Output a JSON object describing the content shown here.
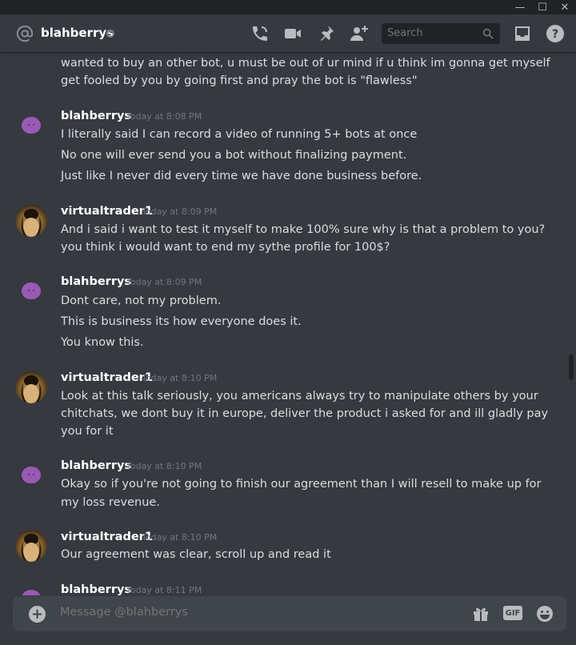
{
  "window": {
    "minimize": "—",
    "maximize": "☐",
    "close": "✕"
  },
  "header": {
    "name": "blahberrys",
    "search_placeholder": "Search"
  },
  "messages": [
    {
      "type": "continuation",
      "lines": [
        "wanted to buy an other bot, u must be out of ur mind if u think im gonna get myself",
        "get fooled by you by going first and pray the bot is \"flawless\""
      ]
    },
    {
      "author": "blahberrys",
      "timestamp": "Today at 8:08 PM",
      "avatar": "purple-blob",
      "lines": [
        "I literally said I can record a video of running 5+ bots at once",
        "No one will ever send you a bot without finalizing payment.",
        "Just like I never did every time we have done business before."
      ]
    },
    {
      "author": "virtualtrader1",
      "timestamp": "Today at 8:09 PM",
      "avatar": "photo",
      "lines": [
        "And i said i want to test it myself to make 100% sure why is that a problem to you?",
        "you think i would want to end my sythe profile for 100$?"
      ]
    },
    {
      "author": "blahberrys",
      "timestamp": "Today at 8:09 PM",
      "avatar": "purple-blob",
      "lines": [
        "Dont care, not my problem.",
        "This is business its how everyone does it.",
        "You know this."
      ]
    },
    {
      "author": "virtualtrader1",
      "timestamp": "Today at 8:10 PM",
      "avatar": "photo",
      "lines": [
        "Look at this talk seriously, you americans always try to manipulate others by your",
        "chitchats, we dont buy it in europe, deliver the product i asked for and ill gladly pay",
        "you for it"
      ]
    },
    {
      "author": "blahberrys",
      "timestamp": "Today at 8:10 PM",
      "avatar": "purple-blob",
      "lines": [
        "Okay so if you're not going to finish our agreement than I will resell to make up for",
        "my loss revenue."
      ]
    },
    {
      "author": "virtualtrader1",
      "timestamp": "Today at 8:10 PM",
      "avatar": "photo",
      "lines": [
        "Our agreement was clear, scroll up and read it"
      ]
    },
    {
      "author": "blahberrys",
      "timestamp": "Today at 8:11 PM",
      "avatar": "purple-blob",
      "lines": []
    }
  ],
  "composer": {
    "placeholder": "Message @blahberrys",
    "gif_label": "GIF",
    "add_label": "+"
  },
  "colors": {
    "background": "#36393f",
    "header_bg": "#36393f",
    "titlebar_bg": "#202225",
    "composer_bg": "#40444b",
    "username": "#ffffff",
    "text": "#dcddde",
    "muted": "#72767d",
    "avatar_purple": "#9b59b6"
  }
}
